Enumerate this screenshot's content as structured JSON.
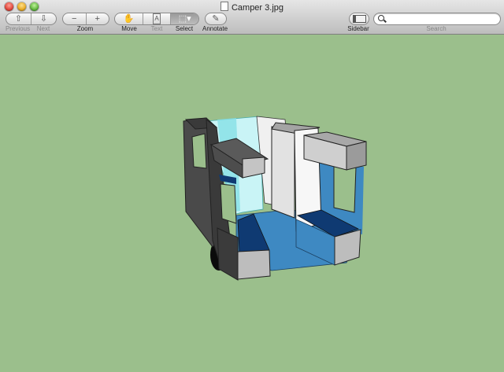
{
  "window": {
    "title": "Camper 3.jpg"
  },
  "toolbar": {
    "previous_label": "Previous",
    "next_label": "Next",
    "zoom_label": "Zoom",
    "move_label": "Move",
    "text_label": "Text",
    "select_label": "Select",
    "annotate_label": "Annotate",
    "sidebar_label": "Sidebar",
    "search_label": "Search",
    "search_value": ""
  },
  "icons": {
    "previous": "up-arrow-icon",
    "next": "down-arrow-icon",
    "zoom_out": "minus-icon",
    "zoom_in": "plus-icon",
    "move": "hand-icon",
    "text": "text-cursor-icon",
    "select": "marquee-icon",
    "annotate": "pencil-icon",
    "sidebar": "sidebar-icon",
    "search": "search-icon"
  },
  "colors": {
    "canvas": "#9bbf8c",
    "floor": "#3e89c2",
    "seat_cushion": "#0f3a72",
    "wall_gray": "#4a4a4a",
    "window_glass": "#c9f4f6"
  }
}
